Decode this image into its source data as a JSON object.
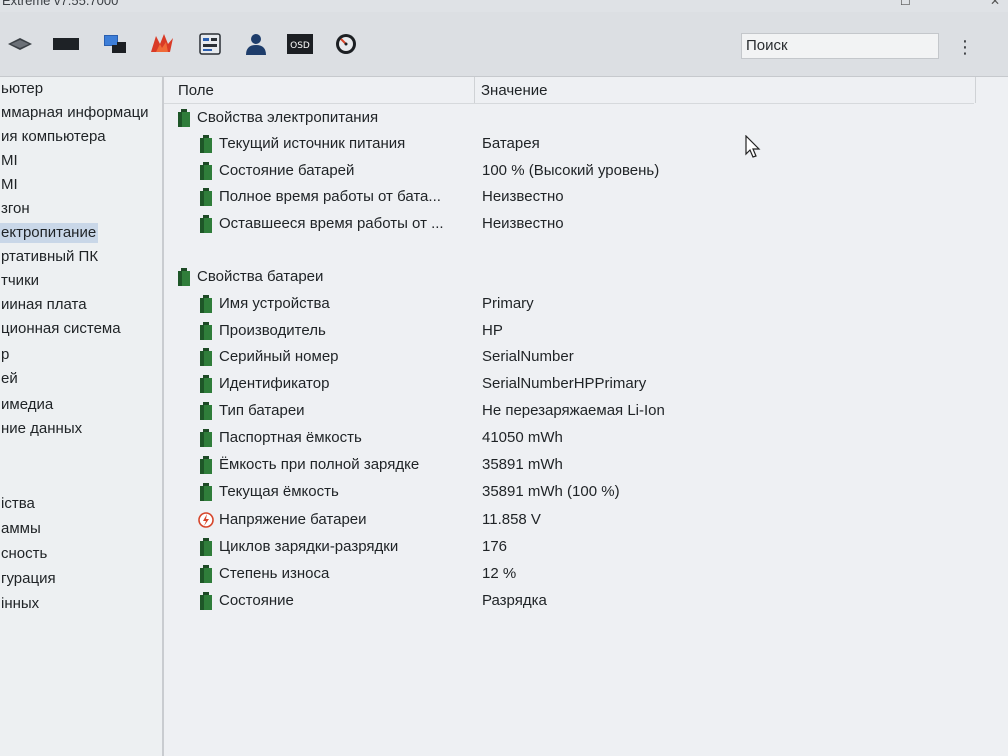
{
  "window": {
    "title": "Extreme v7.55.7000"
  },
  "toolbar": {
    "icons": [
      "chip-icon",
      "display-icon",
      "network-icon",
      "directx-icon",
      "devices-icon",
      "user-icon",
      "osd-icon",
      "gauge-icon"
    ],
    "osd_label": "OSD",
    "search_placeholder": "Поиск",
    "menu_glyph": "⋮"
  },
  "sidebar": {
    "items": [
      {
        "label": "ьютер"
      },
      {
        "label": "ммарная информаци"
      },
      {
        "label": "ия компьютера"
      },
      {
        "label": "MI"
      },
      {
        "label": "MI"
      },
      {
        "label": "згон"
      },
      {
        "label": "ектропитание",
        "selected": true
      },
      {
        "label": "ртативный ПК"
      },
      {
        "label": "тчики"
      },
      {
        "label": "ииная плата"
      },
      {
        "label": "ционная система"
      },
      {
        "label": "р"
      },
      {
        "label": "ей"
      },
      {
        "label": "имедиа"
      },
      {
        "label": "ние данных"
      },
      {
        "label": ""
      },
      {
        "label": ""
      },
      {
        "label": "іства"
      },
      {
        "label": "аммы"
      },
      {
        "label": "сность"
      },
      {
        "label": "гурация"
      },
      {
        "label": "інных"
      }
    ]
  },
  "table": {
    "col_field": "Поле",
    "col_value": "Значение",
    "rows": [
      {
        "kind": "group",
        "field": "Свойства электропитания",
        "value": ""
      },
      {
        "kind": "item",
        "icon": "battery-icon",
        "field": "Текущий источник питания",
        "value": "Батарея"
      },
      {
        "kind": "item",
        "icon": "battery-icon",
        "field": "Состояние батарей",
        "value": "100 % (Высокий уровень)"
      },
      {
        "kind": "item",
        "icon": "battery-icon",
        "field": "Полное время работы от бата...",
        "value": "Неизвестно"
      },
      {
        "kind": "item",
        "icon": "battery-icon",
        "field": "Оставшееся время работы от ...",
        "value": "Неизвестно"
      },
      {
        "kind": "group",
        "field": "Свойства батареи",
        "value": ""
      },
      {
        "kind": "item",
        "icon": "battery-icon",
        "field": "Имя устройства",
        "value": "Primary"
      },
      {
        "kind": "item",
        "icon": "battery-icon",
        "field": "Производитель",
        "value": "HP"
      },
      {
        "kind": "item",
        "icon": "battery-icon",
        "field": "Серийный номер",
        "value": "SerialNumber"
      },
      {
        "kind": "item",
        "icon": "battery-icon",
        "field": "Идентификатор",
        "value": "SerialNumberHPPrimary"
      },
      {
        "kind": "item",
        "icon": "battery-icon",
        "field": "Тип батареи",
        "value": "Не перезаряжаемая Li-Ion"
      },
      {
        "kind": "item",
        "icon": "battery-icon",
        "field": "Паспортная ёмкость",
        "value": "41050 mWh"
      },
      {
        "kind": "item",
        "icon": "battery-icon",
        "field": "Ёмкость при полной зарядке",
        "value": "35891 mWh"
      },
      {
        "kind": "item",
        "icon": "battery-icon",
        "field": "Текущая ёмкость",
        "value": "35891 mWh  (100 %)"
      },
      {
        "kind": "item",
        "icon": "voltage-icon",
        "field": "Напряжение батареи",
        "value": "11.858 V"
      },
      {
        "kind": "item",
        "icon": "battery-icon",
        "field": "Циклов зарядки-разрядки",
        "value": "176"
      },
      {
        "kind": "item",
        "icon": "battery-icon",
        "field": "Степень износа",
        "value": "12 %"
      },
      {
        "kind": "item",
        "icon": "battery-icon",
        "field": "Состояние",
        "value": "Разрядка"
      }
    ]
  },
  "colors": {
    "battery_green": "#2f7d3a",
    "selection": "#c9d7e8",
    "voltage_red": "#d6452a"
  }
}
